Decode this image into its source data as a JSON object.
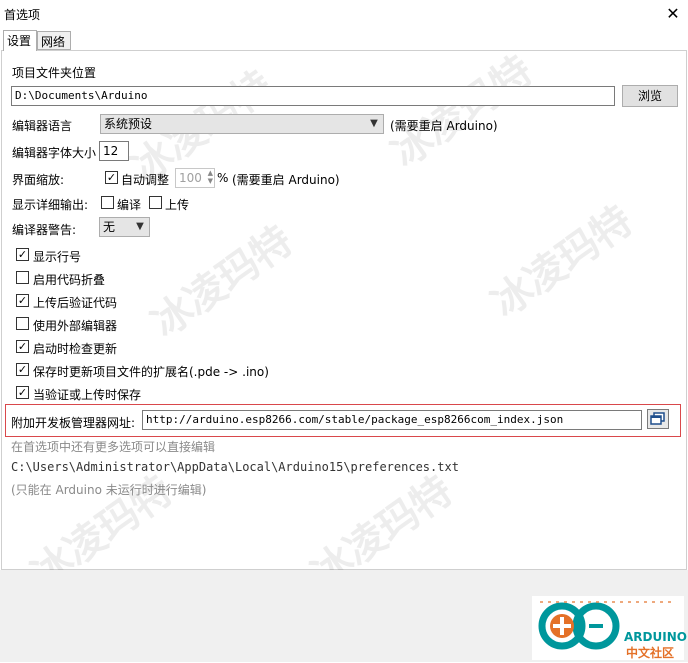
{
  "window": {
    "title": "首选项",
    "close_glyph": "✕"
  },
  "tabs": [
    {
      "label": "设置",
      "active": true
    },
    {
      "label": "网络",
      "active": false
    }
  ],
  "sketchbook": {
    "label": "项目文件夹位置",
    "value": "D:\\Documents\\Arduino",
    "browse_label": "浏览"
  },
  "editor_language": {
    "label": "编辑器语言",
    "selected": "系统预设",
    "note": "(需要重启 Arduino)"
  },
  "font_size": {
    "label": "编辑器字体大小",
    "value": "12"
  },
  "scaling": {
    "label": "界面缩放:",
    "auto_label": "自动调整",
    "auto_checked": true,
    "value": "100",
    "percent": "%",
    "note": "(需要重启 Arduino)"
  },
  "verbose": {
    "label": "显示详细输出:",
    "compile_label": "编译",
    "compile_checked": false,
    "upload_label": "上传",
    "upload_checked": false
  },
  "compiler_warnings": {
    "label": "编译器警告:",
    "selected": "无"
  },
  "options": [
    {
      "label": "显示行号",
      "checked": true
    },
    {
      "label": "启用代码折叠",
      "checked": false
    },
    {
      "label": "上传后验证代码",
      "checked": true
    },
    {
      "label": "使用外部编辑器",
      "checked": false
    },
    {
      "label": "启动时检查更新",
      "checked": true
    },
    {
      "label": "保存时更新项目文件的扩展名(.pde -> .ino)",
      "checked": true
    },
    {
      "label": "当验证或上传时保存",
      "checked": true
    }
  ],
  "board_manager": {
    "label": "附加开发板管理器网址:",
    "value": "http://arduino.esp8266.com/stable/package_esp8266com_index.json"
  },
  "hints": {
    "more_prefs": "在首选项中还有更多选项可以直接编辑",
    "prefs_path": "C:\\Users\\Administrator\\AppData\\Local\\Arduino15\\preferences.txt",
    "edit_note": "(只能在 Arduino 未运行时进行编辑)"
  },
  "watermark": "冰凌玛特",
  "logo": {
    "name": "ARDUINO",
    "subtitle": "中文社区"
  },
  "colors": {
    "highlight_border": "#d9484b",
    "logo_teal": "#00979c",
    "logo_orange": "#e47128"
  }
}
